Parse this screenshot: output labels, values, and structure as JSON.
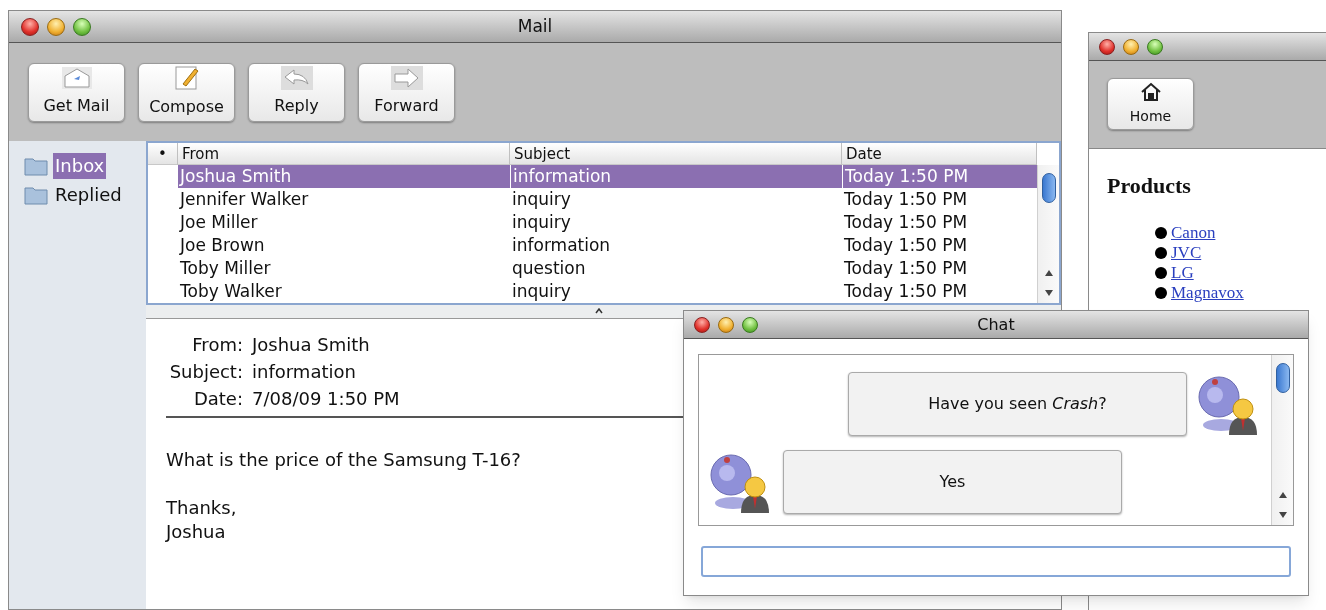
{
  "mail": {
    "title": "Mail",
    "toolbar": [
      {
        "label": "Get Mail",
        "kind": "get"
      },
      {
        "label": "Compose",
        "kind": "compose"
      },
      {
        "label": "Reply",
        "kind": "reply"
      },
      {
        "label": "Forward",
        "kind": "forward"
      }
    ],
    "folders": [
      {
        "label": "Inbox",
        "selected": true
      },
      {
        "label": "Replied",
        "selected": false
      }
    ],
    "table": {
      "columns": [
        "•",
        "From",
        "Subject",
        "Date"
      ],
      "rows": [
        {
          "from": "Joshua Smith",
          "subject": "information",
          "date": "Today 1:50 PM",
          "selected": true
        },
        {
          "from": "Jennifer Walker",
          "subject": "inquiry",
          "date": "Today 1:50 PM",
          "selected": false
        },
        {
          "from": "Joe Miller",
          "subject": "inquiry",
          "date": "Today 1:50 PM",
          "selected": false
        },
        {
          "from": "Joe Brown",
          "subject": "information",
          "date": "Today 1:50 PM",
          "selected": false
        },
        {
          "from": "Toby Miller",
          "subject": "question",
          "date": "Today 1:50 PM",
          "selected": false
        },
        {
          "from": "Toby Walker",
          "subject": "inquiry",
          "date": "Today 1:50 PM",
          "selected": false
        }
      ]
    },
    "message": {
      "fields": [
        {
          "label": "From:",
          "value": "Joshua Smith"
        },
        {
          "label": "Subject:",
          "value": "information"
        },
        {
          "label": "Date:",
          "value": "7/08/09 1:50 PM"
        }
      ],
      "body": [
        [
          "What is the price of the Samsung T-16?"
        ],
        [
          "Thanks,",
          "Joshua"
        ]
      ]
    }
  },
  "browser": {
    "toolbar": [
      {
        "label": "Home",
        "kind": "home"
      }
    ],
    "heading": "Products",
    "links": [
      "Canon",
      "JVC",
      "LG",
      "Magnavox"
    ]
  },
  "chat": {
    "title": "Chat",
    "messages": [
      {
        "text": "Have you seen *Crash*?",
        "kind": "sent"
      },
      {
        "text": "Yes",
        "kind": "received"
      }
    ]
  }
}
